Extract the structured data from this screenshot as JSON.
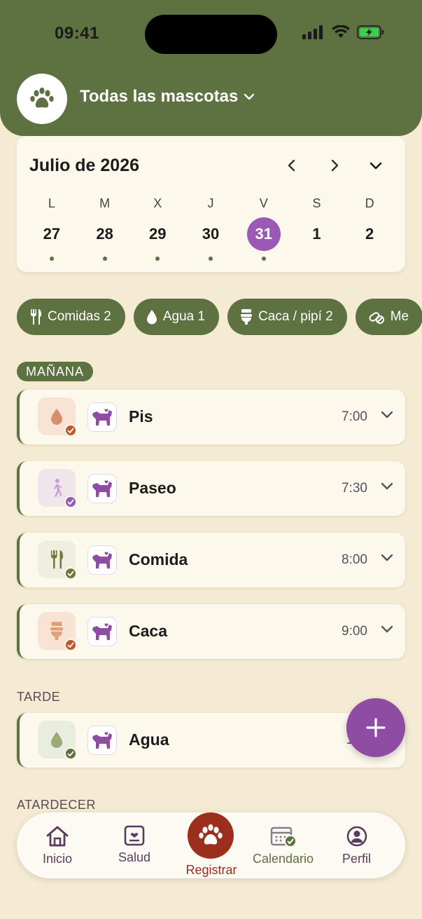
{
  "status_bar": {
    "time": "09:41"
  },
  "header": {
    "pet_selector_label": "Todas las mascotas"
  },
  "calendar": {
    "month_title": "Julio de 2026",
    "days": [
      {
        "letter": "L",
        "num": "27",
        "has_event": true,
        "selected": false
      },
      {
        "letter": "M",
        "num": "28",
        "has_event": true,
        "selected": false
      },
      {
        "letter": "X",
        "num": "29",
        "has_event": true,
        "selected": false
      },
      {
        "letter": "J",
        "num": "30",
        "has_event": true,
        "selected": false
      },
      {
        "letter": "V",
        "num": "31",
        "has_event": true,
        "selected": true
      },
      {
        "letter": "S",
        "num": "1",
        "has_event": false,
        "selected": false
      },
      {
        "letter": "D",
        "num": "2",
        "has_event": false,
        "selected": false
      }
    ]
  },
  "chips": [
    {
      "label": "Comidas 2",
      "icon": "utensils-icon"
    },
    {
      "label": "Agua 1",
      "icon": "water-drop-icon"
    },
    {
      "label": "Caca / pipí 2",
      "icon": "toilet-icon"
    },
    {
      "label": "Me",
      "icon": "pill-icon"
    }
  ],
  "sections": {
    "morning": "MAÑANA",
    "afternoon": "TARDE",
    "evening": "ATARDECER"
  },
  "entries": [
    {
      "title": "Pis",
      "time": "7:00",
      "icon": "water-drop-icon"
    },
    {
      "title": "Paseo",
      "time": "7:30",
      "icon": "walking-icon"
    },
    {
      "title": "Comida",
      "time": "8:00",
      "icon": "utensils-icon"
    },
    {
      "title": "Caca",
      "time": "9:00",
      "icon": "toilet-icon"
    },
    {
      "title": "Agua",
      "time": "12:",
      "icon": "water-drop-icon"
    }
  ],
  "nav": {
    "home": "Inicio",
    "health": "Salud",
    "register": "Registrar",
    "calendar": "Calendario",
    "profile": "Perfil"
  },
  "colors": {
    "primary_green": "#5e7140",
    "accent_purple": "#9b59b6",
    "fab_purple": "#8e4ca3",
    "register_red": "#9c2e1d",
    "background": "#f5ebd3"
  }
}
